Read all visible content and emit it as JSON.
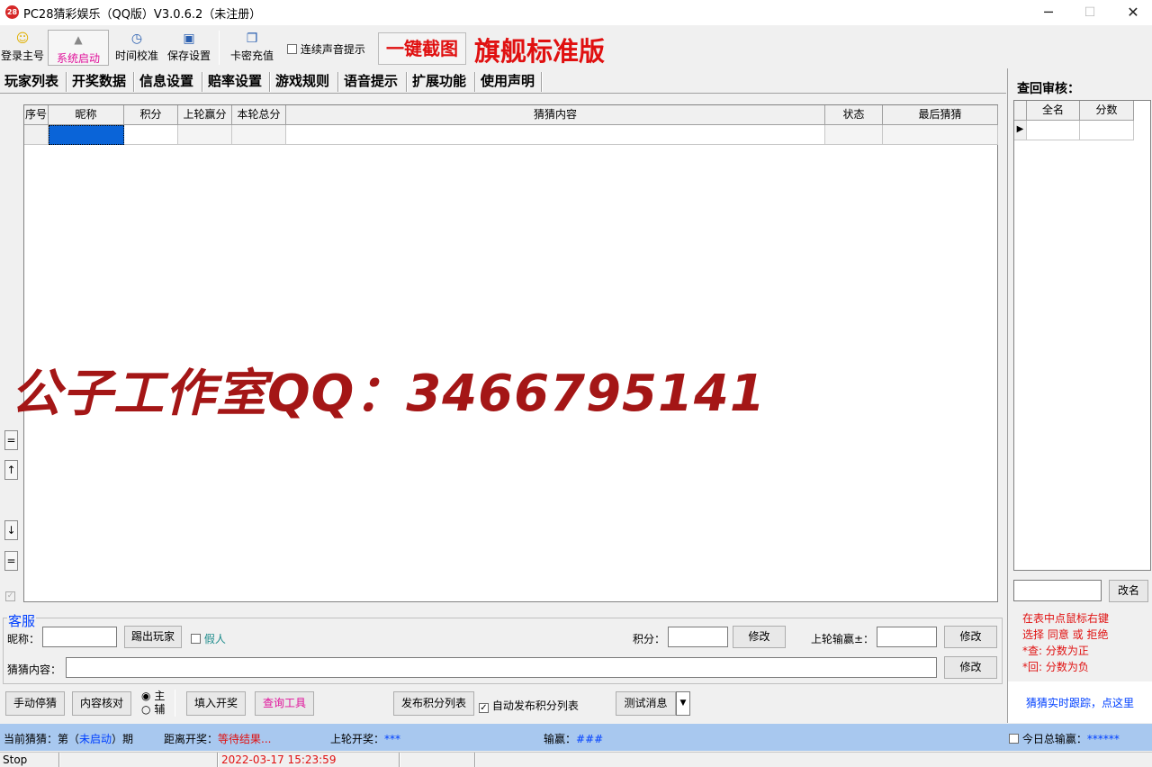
{
  "window": {
    "icon_text": "28",
    "title": "PC28猜彩娱乐（QQ版）V3.0.6.2（未注册）",
    "minimize": "─",
    "maximize": "☐",
    "close": "✕"
  },
  "toolbar": {
    "buttons": [
      {
        "label": "登录主号",
        "icon": "smiley-icon",
        "glyph": "☺"
      },
      {
        "label": "系统启动",
        "icon": "bell-icon",
        "glyph": "▲"
      },
      {
        "label": "时间校准",
        "icon": "stopwatch-icon",
        "glyph": "◷"
      },
      {
        "label": "保存设置",
        "icon": "floppy-icon",
        "glyph": "▣"
      },
      {
        "label": "卡密充值",
        "icon": "cards-icon",
        "glyph": "❐"
      }
    ],
    "sound_checkbox_label": "连续声音提示",
    "capture_button": "一键截图",
    "edition_label": "旗舰标准版",
    "colors": {
      "accent_red": "#e01010",
      "launch_pink": "#e0109a"
    }
  },
  "tabs": [
    "玩家列表",
    "开奖数据",
    "信息设置",
    "赔率设置",
    "游戏规则",
    "语音提示",
    "扩展功能",
    "使用声明"
  ],
  "player_table": {
    "columns": [
      "序号",
      "昵称",
      "积分",
      "上轮赢分",
      "本轮总分",
      "猜猜内容",
      "状态",
      "最后猜猜"
    ]
  },
  "side_buttons": [
    "=",
    "↑",
    "↓",
    "="
  ],
  "watermark": "公子工作室QQ：3466795141",
  "review": {
    "title": "查回审核：",
    "columns": [
      "全名",
      "分数"
    ],
    "rename_button": "改名",
    "help_lines": [
      "在表中点鼠标右键",
      "选择 同意 或 拒绝",
      "*查: 分数为正",
      "*回: 分数为负"
    ],
    "tracking_link": "猜猜实时跟踪，点这里"
  },
  "service": {
    "group_title": "客服",
    "nickname_label": "昵称：",
    "kick_button": "踢出玩家",
    "fake_label": "假人",
    "points_label": "积分：",
    "modify_button": "修改",
    "last_round_label": "上轮输赢±：",
    "guess_content_label": "猜猜内容："
  },
  "bottom_bar": {
    "manual_stop": "手动停猜",
    "content_check": "内容核对",
    "radio_main": "主",
    "radio_aux": "辅",
    "fill_draw": "填入开奖",
    "query_tool": "查询工具",
    "publish_points": "发布积分列表",
    "auto_publish": "自动发布积分列表",
    "test_message": "测试消息"
  },
  "status": {
    "current_prefix": "当前猜猜：第（",
    "current_state": "未启动",
    "current_suffix": "）期",
    "countdown_label": "距离开奖：",
    "countdown_value": "等待结果...",
    "last_draw_label": "上轮开奖：",
    "last_draw_value": "***",
    "win_loss_label": "输赢：",
    "win_loss_value": "###",
    "today_total_label": "今日总输赢：",
    "today_total_value": "******"
  },
  "footer": {
    "state": "Stop",
    "timestamp": "2022-03-17 15:23:59"
  }
}
